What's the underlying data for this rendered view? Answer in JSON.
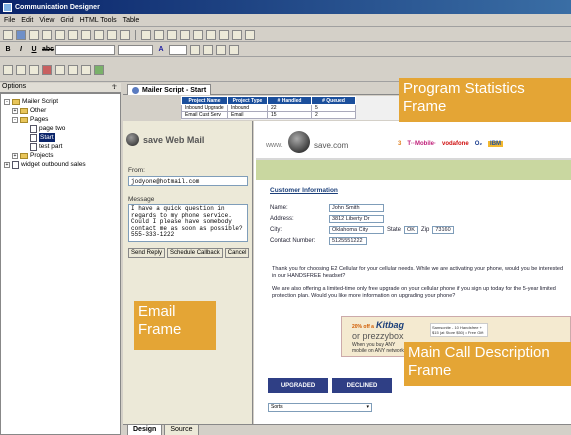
{
  "window": {
    "title": "Communication Designer"
  },
  "menu": [
    "File",
    "Edit",
    "View",
    "Grid",
    "HTML Tools",
    "Table"
  ],
  "panel": {
    "title": "Options",
    "pin": "☥"
  },
  "tree": [
    {
      "label": "Mailer Script",
      "level": 0,
      "kind": "folder",
      "toggle": "-"
    },
    {
      "label": "Other",
      "level": 1,
      "kind": "folder",
      "toggle": "+"
    },
    {
      "label": "Pages",
      "level": 1,
      "kind": "folder",
      "toggle": "-"
    },
    {
      "label": "page two",
      "level": 2,
      "kind": "page"
    },
    {
      "label": "Start",
      "level": 2,
      "kind": "page",
      "selected": true
    },
    {
      "label": "test part",
      "level": 2,
      "kind": "page"
    },
    {
      "label": "Projects",
      "level": 1,
      "kind": "folder",
      "toggle": "+"
    },
    {
      "label": "widget outbound sales",
      "level": 0,
      "kind": "page",
      "toggle": "+"
    }
  ],
  "doc_tab": {
    "label": "Mailer Script - Start"
  },
  "stats": {
    "headers": [
      "Project Name",
      "Project Type",
      "# Handled",
      "# Queued"
    ],
    "rows": [
      [
        "Inbound Upgrade",
        "Inbound",
        "22",
        "5"
      ],
      [
        "Email Cust Serv",
        "Email",
        "15",
        "2"
      ]
    ]
  },
  "email": {
    "brand": "save Web Mail",
    "from_label": "From:",
    "from_value": "jodyone@hotmail.com",
    "message_label": "Message",
    "message_value": "I have a quick question in regards to my phone service. Could I please have somebody contact me as soon as possible? 555-333-1222",
    "buttons": [
      "Send Reply",
      "Schedule Callback",
      "Cancel"
    ]
  },
  "main": {
    "url_brand": "www.",
    "brand": "save.com",
    "partners": [
      "3",
      "T··Mobile·",
      "vodafone",
      "O₂",
      "IBM"
    ],
    "section_title": "Customer Information",
    "fields": {
      "name_label": "Name:",
      "name_value": "John Smith",
      "address_label": "Address:",
      "address_value": "3812 Liberty Dr",
      "city_label": "City:",
      "city_value": "Oklahoma City",
      "state_label": "State",
      "state_value": "OK",
      "zip_label": "Zip",
      "zip_value": "73160",
      "contact_label": "Contact Number:",
      "contact_value": "5125551222"
    },
    "para1": "Thank you for choosing E2 Cellular for your cellular needs. While we are activating your phone, would you be interested in our HANDSFREE headset?",
    "para2": "We are also offering a limited-time only free upgrade on your cellular phone if you sign up today for the 5-year limited protection plan. Would you like more information on upgrading your phone?",
    "promo": {
      "line1": "20% off a",
      "brand1": "Kitbag",
      "line2": "or prezzybox",
      "line3": "When you buy ANY",
      "line4": "mobile on ANY network",
      "side": "Samsonite - 10 Handsfree + $15 (at Store $50) • Free Gift"
    },
    "upgrade_btn": "UPGRADED",
    "decline_btn": "DECLINED",
    "select_value": "Sorts"
  },
  "callouts": {
    "stats": "Program Statistics Frame",
    "email": "Email Frame",
    "main": "Main Call Description Frame"
  },
  "bottom_tabs": [
    "Design",
    "Source"
  ],
  "colors": {
    "titlebar": "#0a246a",
    "callout": "#e4a535",
    "stats_header": "#1b4f9c",
    "band": "#c9d7a0",
    "button": "#2f3f85"
  }
}
